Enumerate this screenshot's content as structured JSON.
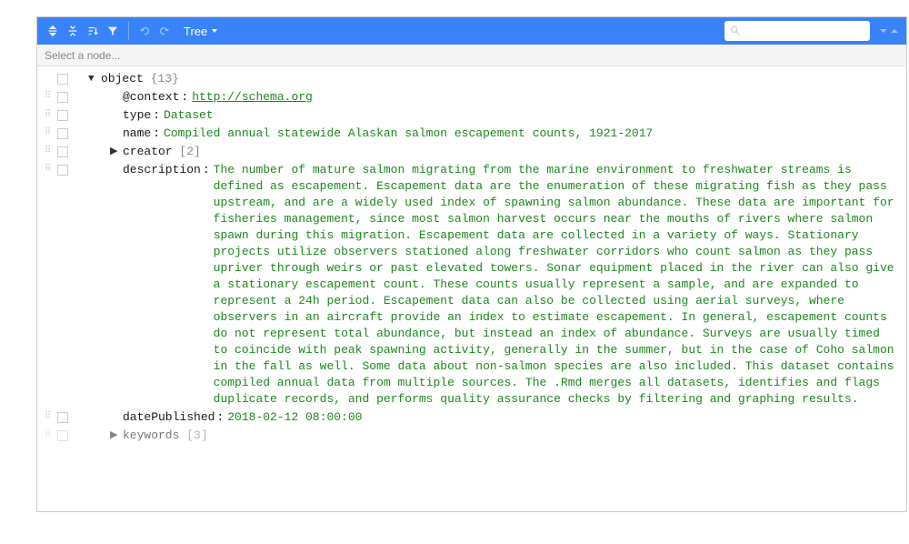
{
  "toolbar": {
    "tree_label": "Tree"
  },
  "breadcrumb": {
    "placeholder": "Select a node..."
  },
  "tree": {
    "root": {
      "label": "object",
      "count": "{13}"
    },
    "context": {
      "key": "@context",
      "value": "http://schema.org"
    },
    "type": {
      "key": "type",
      "value": "Dataset"
    },
    "name": {
      "key": "name",
      "value": "Compiled annual statewide Alaskan salmon escapement counts, 1921-2017"
    },
    "creator": {
      "key": "creator",
      "count": "[2]"
    },
    "description": {
      "key": "description",
      "value": "The number of mature salmon migrating from the marine environment to freshwater streams is defined as escapement. Escapement data are the enumeration of these migrating fish as they pass upstream, and are a widely used index of spawning salmon abundance. These data are important for fisheries management, since most salmon harvest occurs near the mouths of rivers where salmon spawn during this migration. Escapement data are collected in a variety of ways. Stationary projects utilize observers stationed along freshwater corridors who count salmon as they pass upriver through weirs or past elevated towers. Sonar equipment placed in the river can also give a stationary escapement count. These counts usually represent a sample, and are expanded to represent a 24h period. Escapement data can also be collected using aerial surveys, where observers in an aircraft provide an index to estimate escapement. In general, escapement counts do not represent total abundance, but instead an index of abundance. Surveys are usually timed to coincide with peak spawning activity, generally in the summer, but in the case of Coho salmon in the fall as well. Some data about non-salmon species are also included. This dataset contains compiled annual data from multiple sources. The .Rmd merges all datasets, identifies and flags duplicate records, and performs quality assurance checks by filtering and graphing results."
    },
    "datePublished": {
      "key": "datePublished",
      "value": "2018-02-12 08:00:00"
    },
    "keywords": {
      "key": "keywords",
      "count": "[3]"
    }
  }
}
